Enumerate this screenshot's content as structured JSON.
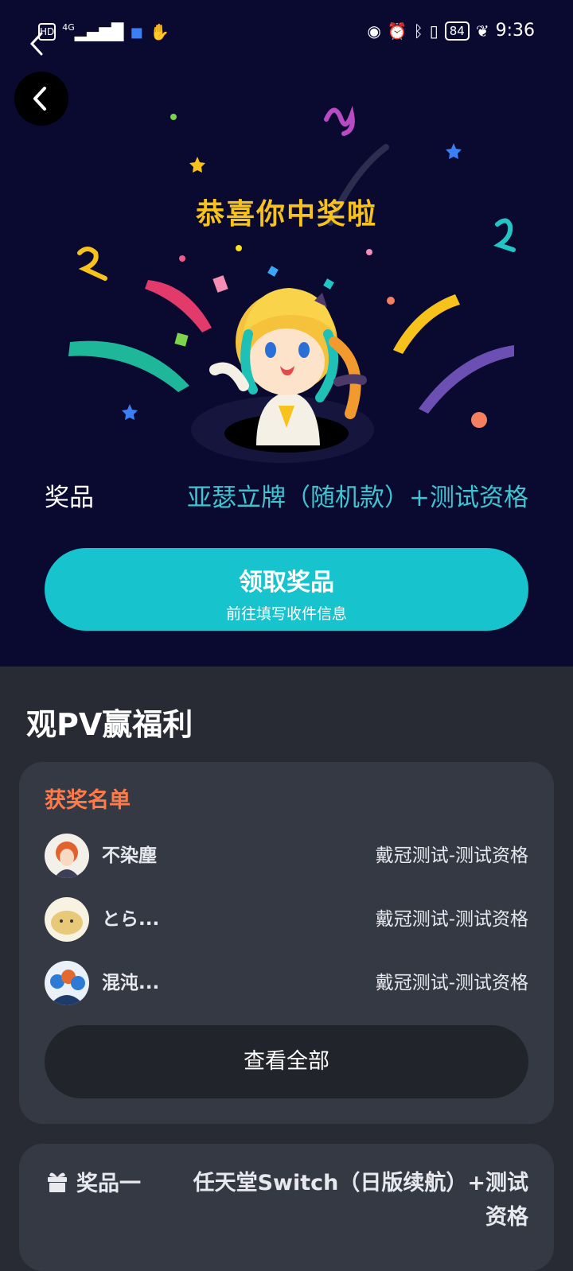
{
  "statusbar": {
    "left_icons": [
      "hd-icon",
      "signal-4g-icon",
      "shield-app-icon",
      "hand-app-icon"
    ],
    "hd_label": "HD",
    "network_label": "4G",
    "right_icons": [
      "eye-icon",
      "alarm-icon",
      "bluetooth-icon",
      "vibrate-icon",
      "battery-icon",
      "leaf-icon"
    ],
    "battery": "84",
    "time": "9:36"
  },
  "hero": {
    "title": "恭喜你中奖啦",
    "prize_label": "奖品",
    "prize_value": "亚瑟立牌（随机款）+测试资格",
    "claim_button": "领取奖品",
    "claim_sub": "前往填写收件信息",
    "colors": {
      "background": "#0a0a31",
      "title": "#f7c21b",
      "accent": "#17c3cd"
    }
  },
  "section": {
    "title": "观PV赢福利"
  },
  "winners": {
    "title": "获奖名单",
    "items": [
      {
        "name": "不染塵",
        "prize": "戴冠测试-测试资格"
      },
      {
        "name": "とら...",
        "prize": "戴冠测试-测试资格"
      },
      {
        "name": "混沌...",
        "prize": "戴冠测试-测试资格"
      }
    ],
    "view_all": "查看全部"
  },
  "prize_one": {
    "label": "奖品一",
    "value": "任天堂Switch（日版续航）+测试资格"
  }
}
